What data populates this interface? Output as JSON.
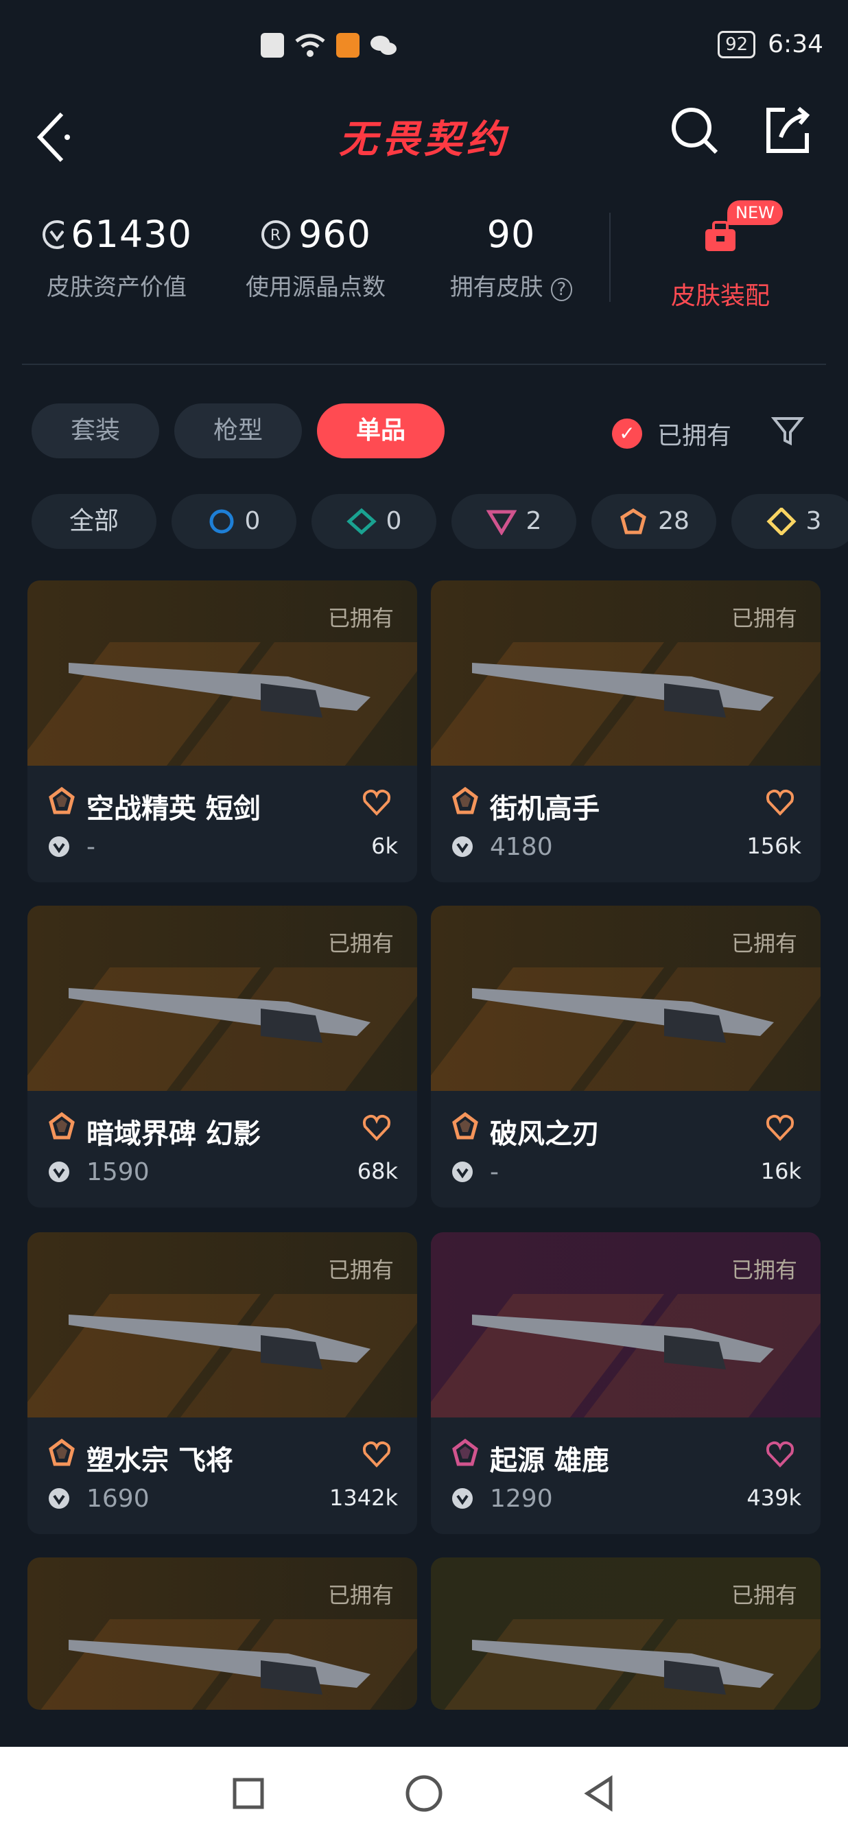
{
  "status": {
    "battery": "92",
    "time": "6:34"
  },
  "header": {
    "title": "无畏契约"
  },
  "stats": {
    "asset_value": "61430",
    "asset_label": "皮肤资产价值",
    "radianite": "960",
    "radianite_label": "使用源晶点数",
    "owned": "90",
    "owned_label": "拥有皮肤",
    "loadout_label": "皮肤装配",
    "new_badge": "NEW"
  },
  "filters": {
    "tabs": [
      "套装",
      "枪型",
      "单品"
    ],
    "active_tab": "单品",
    "owned_toggle": "已拥有"
  },
  "tiers": [
    {
      "label": "全部",
      "count": ""
    },
    {
      "label": "",
      "count": "0",
      "icon": "select-tier-icon",
      "color": "#1e7fd6"
    },
    {
      "label": "",
      "count": "0",
      "icon": "deluxe-tier-icon",
      "color": "#1aa291"
    },
    {
      "label": "",
      "count": "2",
      "icon": "premium-tier-icon",
      "color": "#d1548e"
    },
    {
      "label": "",
      "count": "28",
      "icon": "exclusive-tier-icon",
      "color": "#f5955b"
    },
    {
      "label": "",
      "count": "3",
      "icon": "ultra-tier-icon",
      "color": "#f9d563"
    }
  ],
  "cards": [
    {
      "name": "空战精英 短剑",
      "price": "-",
      "likes": "6k",
      "owned": "已拥有",
      "tier_color": "#f5955b"
    },
    {
      "name": "街机高手",
      "price": "4180",
      "likes": "156k",
      "owned": "已拥有",
      "tier_color": "#f5955b"
    },
    {
      "name": "暗域界碑 幻影",
      "price": "1590",
      "likes": "68k",
      "owned": "已拥有",
      "tier_color": "#f5955b"
    },
    {
      "name": "破风之刃",
      "price": "-",
      "likes": "16k",
      "owned": "已拥有",
      "tier_color": "#f5955b"
    },
    {
      "name": "塑水宗 飞将",
      "price": "1690",
      "likes": "1342k",
      "owned": "已拥有",
      "tier_color": "#f5955b"
    },
    {
      "name": "起源 雄鹿",
      "price": "1290",
      "likes": "439k",
      "owned": "已拥有",
      "tier_color": "#d1548e"
    },
    {
      "name": "",
      "price": "",
      "likes": "",
      "owned": "已拥有",
      "tier_color": "#f5955b"
    },
    {
      "name": "",
      "price": "",
      "likes": "",
      "owned": "已拥有",
      "tier_color": "#f5955b"
    }
  ]
}
